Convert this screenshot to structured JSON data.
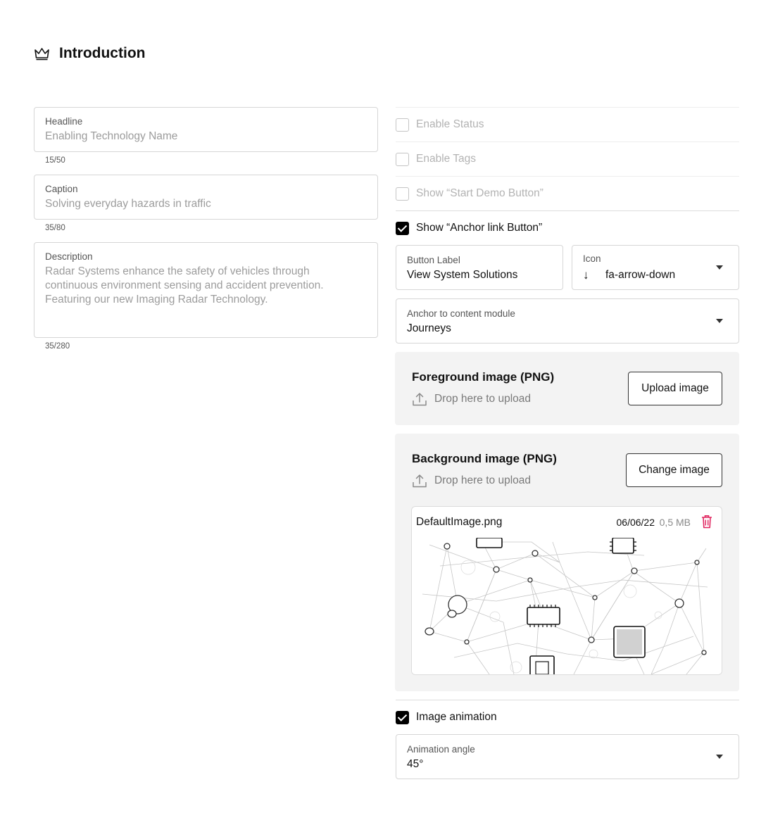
{
  "header": {
    "title": "Introduction",
    "icon": "crown-icon"
  },
  "left_fields": {
    "headline": {
      "label": "Headline",
      "placeholder": "Enabling Technology Name",
      "counter": "15/50"
    },
    "caption": {
      "label": "Caption",
      "placeholder": "Solving everyday hazards in traffic",
      "counter": "35/80"
    },
    "description": {
      "label": "Description",
      "placeholder": "Radar Systems enhance the safety of vehicles through continuous environment sensing and accident prevention. Featuring our new Imaging Radar Technology.",
      "counter": "35/280"
    }
  },
  "options": {
    "enable_status": {
      "label": "Enable Status",
      "checked": false,
      "disabled": true
    },
    "enable_tags": {
      "label": "Enable Tags",
      "checked": false,
      "disabled": true
    },
    "show_start_demo": {
      "label": "Show “Start Demo Button”",
      "checked": false,
      "disabled": true
    },
    "show_anchor_link": {
      "label": "Show “Anchor link Button”",
      "checked": true
    }
  },
  "anchor_button": {
    "button_label": {
      "label": "Button Label",
      "value": "View System Solutions"
    },
    "icon": {
      "label": "Icon",
      "value": "fa-arrow-down",
      "glyph": "↓"
    },
    "anchor_module": {
      "label": "Anchor to content module",
      "value": "Journeys"
    }
  },
  "foreground_image": {
    "title": "Foreground image (PNG)",
    "drop_text": "Drop here to upload",
    "button": "Upload image"
  },
  "background_image": {
    "title": "Background image (PNG)",
    "drop_text": "Drop here to upload",
    "button": "Change image",
    "file": {
      "name": "DefaultImage.png",
      "date": "06/06/22",
      "size": "0,5 MB"
    }
  },
  "image_animation": {
    "label": "Image animation",
    "checked": true
  },
  "animation_angle": {
    "label": "Animation angle",
    "value": "45°"
  },
  "colors": {
    "accent": "#000000",
    "delete": "#e0245e",
    "panel_bg": "#f3f3f3",
    "border": "#d6d6d6"
  }
}
